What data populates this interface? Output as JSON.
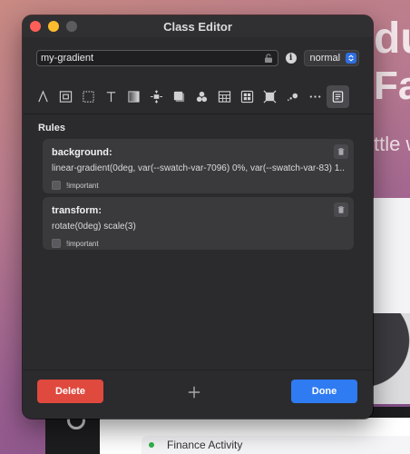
{
  "background_app": {
    "heading_line1": "du",
    "heading_line2": "Fa",
    "subtext": "ttle w",
    "activity_label": "Finance Activity"
  },
  "window": {
    "title": "Class Editor",
    "class_name_value": "my-gradient",
    "state_select": "normal"
  },
  "toolbar": {
    "tools": [
      {
        "icon": "typography-icon"
      },
      {
        "icon": "box-model-icon"
      },
      {
        "icon": "border-icon"
      },
      {
        "icon": "text-icon"
      },
      {
        "icon": "background-icon"
      },
      {
        "icon": "spacing-icon"
      },
      {
        "icon": "shadow-icon"
      },
      {
        "icon": "effects-icon"
      },
      {
        "icon": "grid-icon"
      },
      {
        "icon": "layout-icon"
      },
      {
        "icon": "transform-icon"
      },
      {
        "icon": "animation-icon"
      },
      {
        "icon": "more-icon"
      },
      {
        "icon": "css-rules-icon",
        "active": true
      }
    ]
  },
  "rules": {
    "label": "Rules",
    "items": [
      {
        "property": "background:",
        "value": "linear-gradient(0deg, var(--swatch-var-7096)   0%, var(--swatch-var-83) 1...",
        "important_label": "!important"
      },
      {
        "property": "transform:",
        "value": "rotate(0deg) scale(3)",
        "important_label": "!important"
      }
    ]
  },
  "footer": {
    "delete_label": "Delete",
    "done_label": "Done"
  },
  "colors": {
    "delete": "#e0493e",
    "done": "#2f7bf2",
    "window_bg": "#2b2b2d"
  }
}
